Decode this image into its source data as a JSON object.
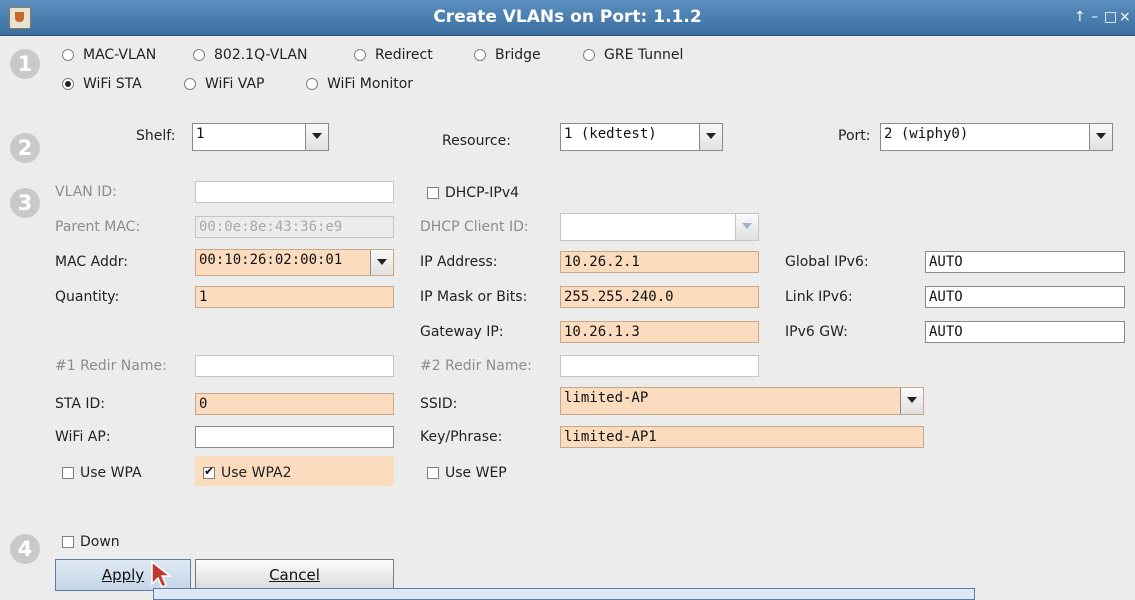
{
  "window": {
    "title": "Create VLANs on Port: 1.1.2",
    "controls": [
      "↑",
      "–",
      "□",
      "×"
    ]
  },
  "steps": [
    "1",
    "2",
    "3",
    "4"
  ],
  "types": {
    "row1": [
      "MAC-VLAN",
      "802.1Q-VLAN",
      "Redirect",
      "Bridge",
      "GRE Tunnel"
    ],
    "row2": [
      "WiFi STA",
      "WiFi VAP",
      "WiFi Monitor"
    ],
    "selected": "WiFi STA"
  },
  "location": {
    "shelf_label": "Shelf:",
    "shelf_value": "1",
    "resource_label": "Resource:",
    "resource_value": "1 (kedtest)",
    "port_label": "Port:",
    "port_value": "2 (wiphy0)"
  },
  "form": {
    "vlan_id_label": "VLAN ID:",
    "vlan_id": "",
    "parent_mac_label": "Parent MAC:",
    "parent_mac": "00:0e:8e:43:36:e9",
    "mac_addr_label": "MAC Addr:",
    "mac_addr": "00:10:26:02:00:01",
    "quantity_label": "Quantity:",
    "quantity": "1",
    "redir1_label": "#1 Redir Name:",
    "redir1": "",
    "sta_id_label": "STA ID:",
    "sta_id": "0",
    "wifi_ap_label": "WiFi AP:",
    "wifi_ap": "",
    "use_wpa": "Use WPA",
    "use_wpa2": "Use WPA2",
    "dhcp_label": "DHCP-IPv4",
    "dhcp_client_label": "DHCP Client ID:",
    "dhcp_client": "",
    "ip_label": "IP Address:",
    "ip": "10.26.2.1",
    "mask_label": "IP Mask or Bits:",
    "mask": "255.255.240.0",
    "gw_label": "Gateway IP:",
    "gw": "10.26.1.3",
    "redir2_label": "#2 Redir Name:",
    "redir2": "",
    "ssid_label": "SSID:",
    "ssid": "limited-AP",
    "key_label": "Key/Phrase:",
    "key": "limited-AP1",
    "use_wep": "Use WEP",
    "gipv6_label": "Global IPv6:",
    "gipv6": "AUTO",
    "lipv6_label": "Link IPv6:",
    "lipv6": "AUTO",
    "ipv6gw_label": "IPv6 GW:",
    "ipv6gw": "AUTO"
  },
  "down_label": "Down",
  "buttons": {
    "apply": "Apply",
    "cancel": "Cancel"
  },
  "colors": {
    "titlebar": "#4a80b0",
    "highlight": "#fbdcbf"
  }
}
